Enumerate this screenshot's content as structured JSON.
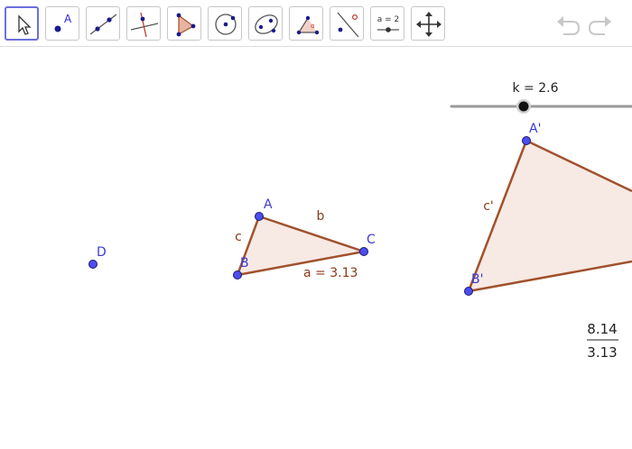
{
  "toolbar": {
    "tools": [
      {
        "icon": "move-icon"
      },
      {
        "icon": "point-icon",
        "label": "A"
      },
      {
        "icon": "line-icon"
      },
      {
        "icon": "perpendicular-line-icon"
      },
      {
        "icon": "polygon-icon"
      },
      {
        "icon": "circle-center-point-icon"
      },
      {
        "icon": "ellipse-icon"
      },
      {
        "icon": "angle-icon"
      },
      {
        "icon": "reflect-icon"
      },
      {
        "icon": "slider-icon",
        "label": "a = 2"
      },
      {
        "icon": "move-graphics-view-icon"
      }
    ],
    "undo_icon": "undo-icon",
    "redo_icon": "redo-icon"
  },
  "slider": {
    "label": "k = 2.6",
    "value": 2.6
  },
  "points": {
    "A": "A",
    "B": "B",
    "C": "C",
    "D": "D",
    "A_prime": "A'",
    "B_prime": "B'"
  },
  "segments": {
    "a": "a = 3.13",
    "b": "b",
    "c": "c",
    "c_prime": "c'"
  },
  "fraction": {
    "numerator": "8.14",
    "denominator": "3.13"
  },
  "colors": {
    "accent": "#6e6ee0",
    "point_fill": "#4d4df0",
    "segment": "#a0522d",
    "polygon_fill": "#f7e9e4",
    "point_label": "#3a3ad9",
    "segment_label": "#8b3a1a"
  }
}
